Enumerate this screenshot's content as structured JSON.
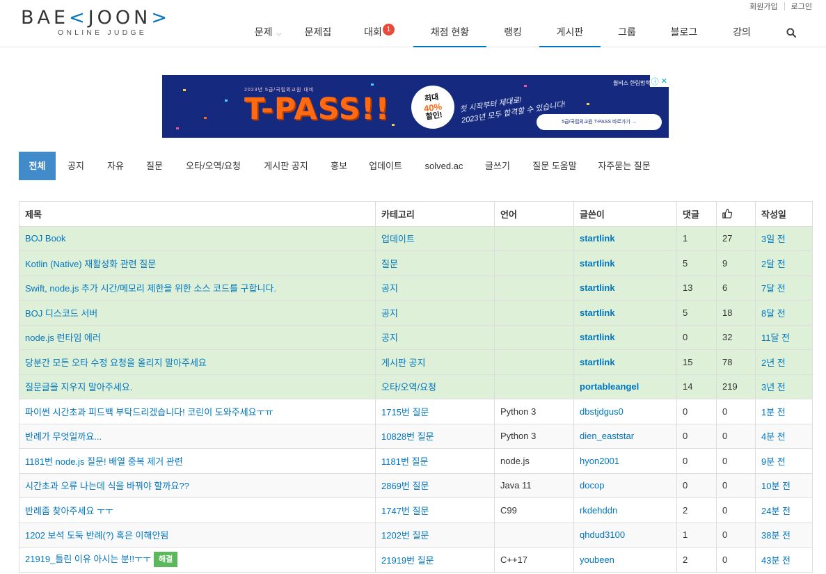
{
  "logo": {
    "main_left": "BAE",
    "main_bracket_open": "<",
    "main_right": "JOON",
    "main_bracket_close": ">",
    "sub": "ONLINE JUDGE"
  },
  "top_links": {
    "signup": "회원가입",
    "login": "로그인"
  },
  "nav": {
    "items": [
      {
        "label": "문제",
        "has_caret": true
      },
      {
        "label": "문제집"
      },
      {
        "label": "대회",
        "badge": "1"
      },
      {
        "label": "채점 현황",
        "active": true
      },
      {
        "label": "랭킹"
      },
      {
        "label": "게시판",
        "active": true
      },
      {
        "label": "그룹"
      },
      {
        "label": "블로그"
      },
      {
        "label": "강의"
      }
    ],
    "search_icon": "search-icon"
  },
  "banner": {
    "subtitle": "2023년 5급/국립외교원 대비",
    "headline": "T-PASS!!",
    "stamp_line1": "최대",
    "stamp_pct": "40%",
    "stamp_line2": "할인!",
    "hand_line1": "첫 시작부터 제대로!",
    "hand_line2": "2023년 모두 합격할 수 있습니다!",
    "brand": "윌비스 한림법학원",
    "cta": "5급/국립외교원 T-PASS 바로가기 →"
  },
  "tabs": [
    "전체",
    "공지",
    "자유",
    "질문",
    "오타/오역/요청",
    "게시판 공지",
    "홍보",
    "업데이트",
    "solved.ac",
    "글쓰기",
    "질문 도움말",
    "자주묻는 질문"
  ],
  "table": {
    "headers": [
      "제목",
      "카테고리",
      "언어",
      "글쓴이",
      "댓글",
      "",
      "작성일"
    ],
    "like_icon": "thumbs-up-icon",
    "rows": [
      {
        "title": "BOJ Book",
        "category": "업데이트",
        "language": "",
        "author": "startlink",
        "comments": "1",
        "likes": "27",
        "date": "3일 전",
        "kind": "notice"
      },
      {
        "title": "Kotlin (Native) 재활성화 관련 질문",
        "category": "질문",
        "language": "",
        "author": "startlink",
        "comments": "5",
        "likes": "9",
        "date": "2달 전",
        "kind": "notice"
      },
      {
        "title": "Swift, node.js 추가 시간/메모리 제한을 위한 소스 코드를 구합니다.",
        "category": "공지",
        "language": "",
        "author": "startlink",
        "comments": "13",
        "likes": "6",
        "date": "7달 전",
        "kind": "notice"
      },
      {
        "title": "BOJ 디스코드 서버",
        "category": "공지",
        "language": "",
        "author": "startlink",
        "comments": "5",
        "likes": "18",
        "date": "8달 전",
        "kind": "notice"
      },
      {
        "title": "node.js 런타임 에러",
        "category": "공지",
        "language": "",
        "author": "startlink",
        "comments": "0",
        "likes": "32",
        "date": "11달 전",
        "kind": "notice"
      },
      {
        "title": "당분간 모든 오타 수정 요청을 올리지 말아주세요",
        "category": "게시판 공지",
        "language": "",
        "author": "startlink",
        "comments": "15",
        "likes": "78",
        "date": "2년 전",
        "kind": "notice"
      },
      {
        "title": "질문글을 지우지 말아주세요.",
        "category": "오타/오역/요청",
        "language": "",
        "author": "portableangel",
        "comments": "14",
        "likes": "219",
        "date": "3년 전",
        "kind": "notice",
        "author_style": "orange"
      },
      {
        "title": "파이썬 시간초과 피드백 부탁드리겠습니다! 코린이 도와주세요ㅜㅠ",
        "category": "1715번 질문",
        "language": "Python 3",
        "author": "dbstjdgus0",
        "comments": "0",
        "likes": "0",
        "date": "1분 전",
        "kind": "normal"
      },
      {
        "title": "반례가 무엇일까요...",
        "category": "10828번 질문",
        "language": "Python 3",
        "author": "dien_eaststar",
        "comments": "0",
        "likes": "0",
        "date": "4분 전",
        "kind": "stripe"
      },
      {
        "title": "1181번 node.js 질문! 배열 중복 제거 관련",
        "category": "1181번 질문",
        "language": "node.js",
        "author": "hyon2001",
        "comments": "0",
        "likes": "0",
        "date": "9분 전",
        "kind": "normal"
      },
      {
        "title": "시간초과 오류 나는데 식을 바꿔야 할까요??",
        "category": "2869번 질문",
        "language": "Java 11",
        "author": "docop",
        "comments": "0",
        "likes": "0",
        "date": "10분 전",
        "kind": "stripe"
      },
      {
        "title": "반례좀 찾아주세요 ㅜㅜ",
        "category": "1747번 질문",
        "language": "C99",
        "author": "rkdehddn",
        "comments": "2",
        "likes": "0",
        "date": "24분 전",
        "kind": "normal"
      },
      {
        "title": "1202 보석 도둑 반례(?) 혹은 이해안됨",
        "category": "1202번 질문",
        "language": "",
        "author": "qhdud3100",
        "comments": "1",
        "likes": "0",
        "date": "38분 전",
        "kind": "stripe"
      },
      {
        "title": "21919_틀린 이유 아시는 분!!ㅜㅜ",
        "category": "21919번 질문",
        "language": "C++17",
        "author": "youbeen",
        "comments": "2",
        "likes": "0",
        "date": "43분 전",
        "kind": "normal",
        "solved_badge": "해결"
      }
    ]
  },
  "colors": {
    "accent": "#0076c0",
    "tab_active": "#428bca",
    "notice_row": "#dff0d8",
    "badge_red": "#e74c3c",
    "solved_green": "#5cb85c",
    "orange_author": "#ff8c00"
  }
}
